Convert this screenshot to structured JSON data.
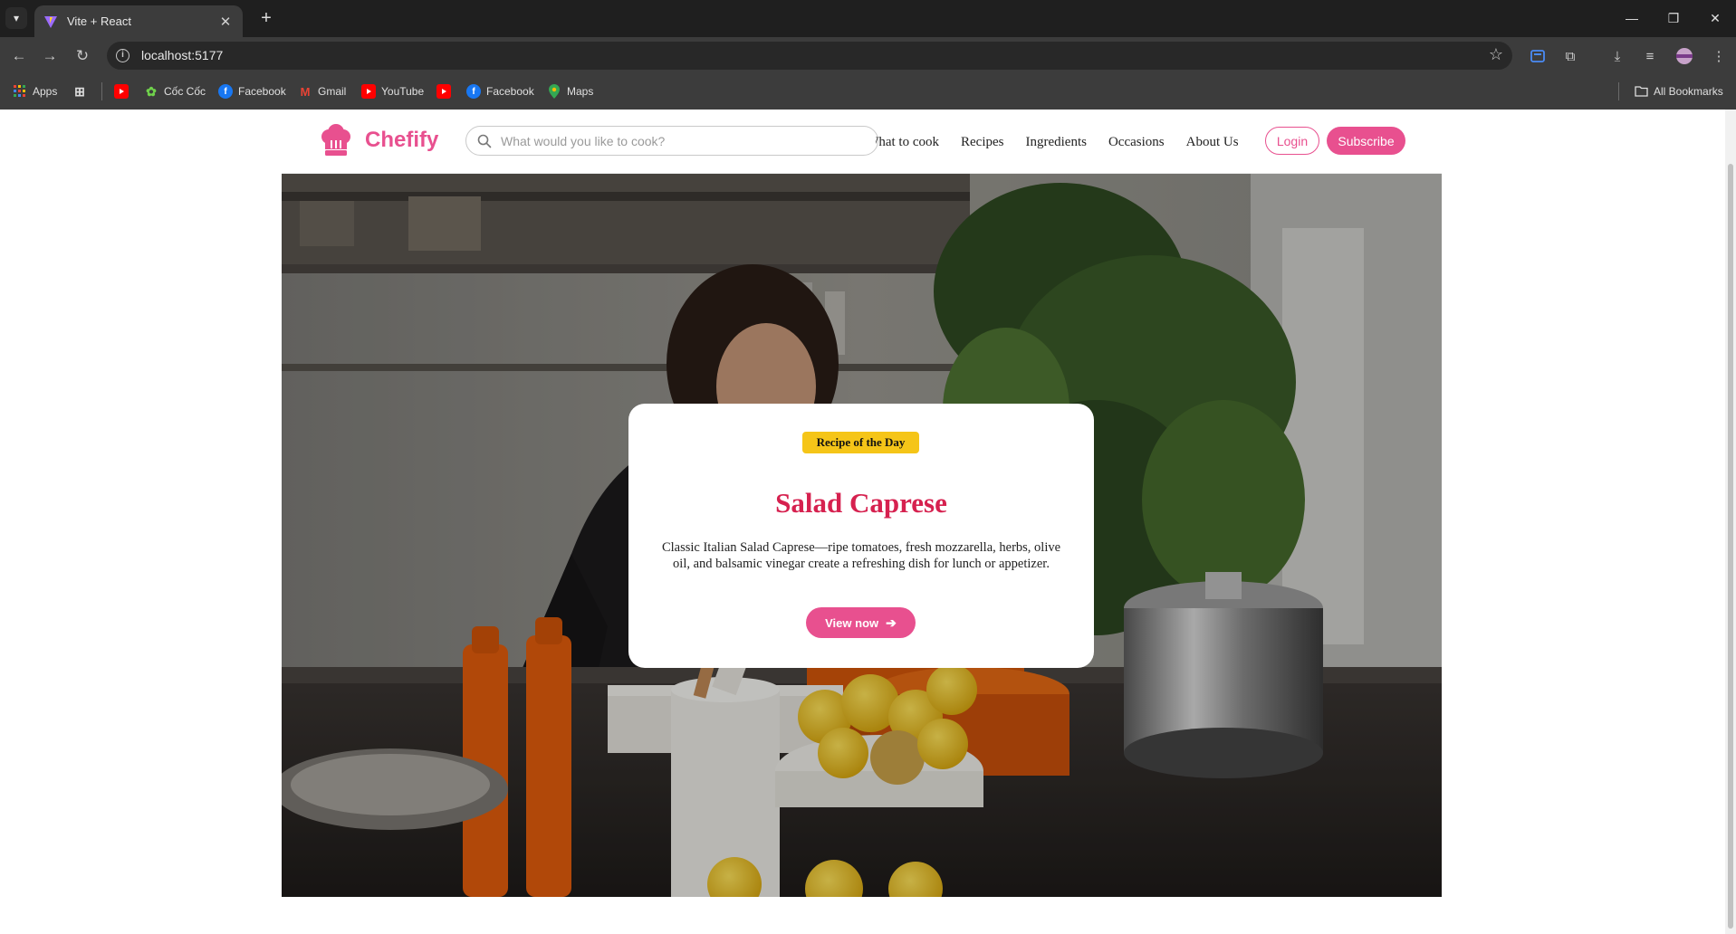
{
  "browser": {
    "tab_title": "Vite + React",
    "url": "localhost:5177",
    "bookmarks": [
      {
        "label": "Apps",
        "icon": "apps-grid-icon"
      },
      {
        "label": "",
        "icon": "tab-groups-icon"
      },
      {
        "label": "",
        "icon": "youtube-icon"
      },
      {
        "label": "Cốc Cốc",
        "icon": "coccoc-icon"
      },
      {
        "label": "Facebook",
        "icon": "facebook-icon"
      },
      {
        "label": "Gmail",
        "icon": "gmail-icon"
      },
      {
        "label": "YouTube",
        "icon": "youtube-icon"
      },
      {
        "label": "",
        "icon": "youtube-icon"
      },
      {
        "label": "Facebook",
        "icon": "facebook-icon"
      },
      {
        "label": "Maps",
        "icon": "maps-icon"
      }
    ],
    "all_bookmarks_label": "All Bookmarks"
  },
  "header": {
    "brand": "Chefify",
    "search_placeholder": "What would you like to cook?",
    "nav_partial": "What to cook",
    "nav": [
      "Recipes",
      "Ingredients",
      "Occasions",
      "About Us"
    ],
    "login_label": "Login",
    "subscribe_label": "Subscribe"
  },
  "hero": {
    "badge": "Recipe of the Day",
    "title": "Salad Caprese",
    "description": "Classic Italian Salad Caprese—ripe tomatoes, fresh mozzarella, herbs, olive oil, and balsamic vinegar create a refreshing dish for lunch or appetizer.",
    "button_label": "View now"
  },
  "colors": {
    "brand_pink": "#e8508f",
    "title_red": "#d6214f",
    "badge_yellow": "#f5c518"
  }
}
